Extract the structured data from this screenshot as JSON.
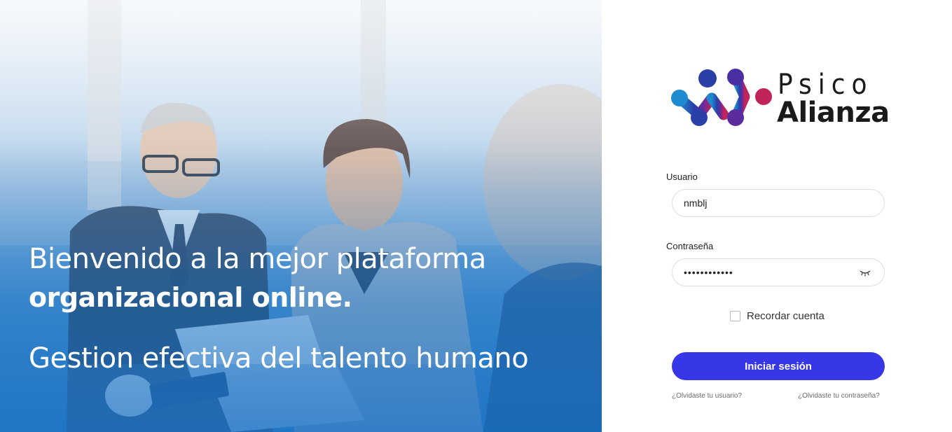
{
  "hero": {
    "line1": "Bienvenido a la mejor plataforma",
    "line2": "organizacional online.",
    "line3": "Gestion efectiva del talento humano"
  },
  "brand": {
    "name_top": "Psico",
    "name_bottom": "Alianza",
    "colors": [
      "#1e8bd0",
      "#2a3fa8",
      "#6a2a9c",
      "#c0245a"
    ]
  },
  "login": {
    "user_label": "Usuario",
    "user_value": "nmblj",
    "pass_label": "Contraseña",
    "pass_value": "••••••••••••",
    "remember_label": "Recordar cuenta",
    "submit_label": "Iniciar sesión",
    "forgot_user": "¿Olvidaste tu usuario?",
    "forgot_pass": "¿Olvidaste tu contraseña?",
    "eye_icon": "eye-closed-icon",
    "accent": "#3737e8"
  }
}
